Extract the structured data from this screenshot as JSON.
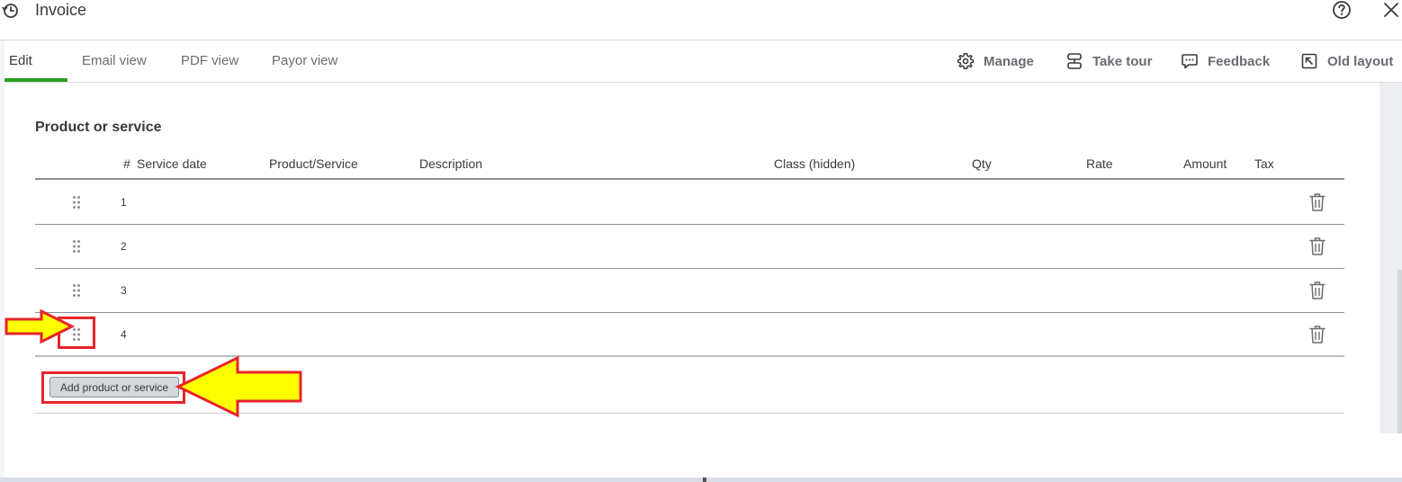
{
  "header": {
    "title": "Invoice"
  },
  "tabs": [
    {
      "label": "Edit",
      "active": true
    },
    {
      "label": "Email view",
      "active": false
    },
    {
      "label": "PDF view",
      "active": false
    },
    {
      "label": "Payor view",
      "active": false
    }
  ],
  "actions": {
    "manage": "Manage",
    "take_tour": "Take tour",
    "feedback": "Feedback",
    "old_layout": "Old layout"
  },
  "section": {
    "title": "Product or service"
  },
  "table": {
    "columns": [
      "#",
      "Service date",
      "Product/Service",
      "Description",
      "Class (hidden)",
      "Qty",
      "Rate",
      "Amount",
      "Tax"
    ],
    "rows": [
      {
        "num": "1"
      },
      {
        "num": "2"
      },
      {
        "num": "3"
      },
      {
        "num": "4"
      }
    ]
  },
  "add_button": {
    "label": "Add product or service"
  },
  "colors": {
    "accent_green": "#2ca01c",
    "annotation_red": "#e8242b",
    "annotation_yellow": "#ffff00"
  },
  "icons": [
    "history-icon",
    "help-icon",
    "close-icon",
    "gear-icon",
    "tour-icon",
    "feedback-icon",
    "old-layout-icon",
    "drag-handle-icon",
    "trash-icon",
    "arrow-annotation"
  ]
}
